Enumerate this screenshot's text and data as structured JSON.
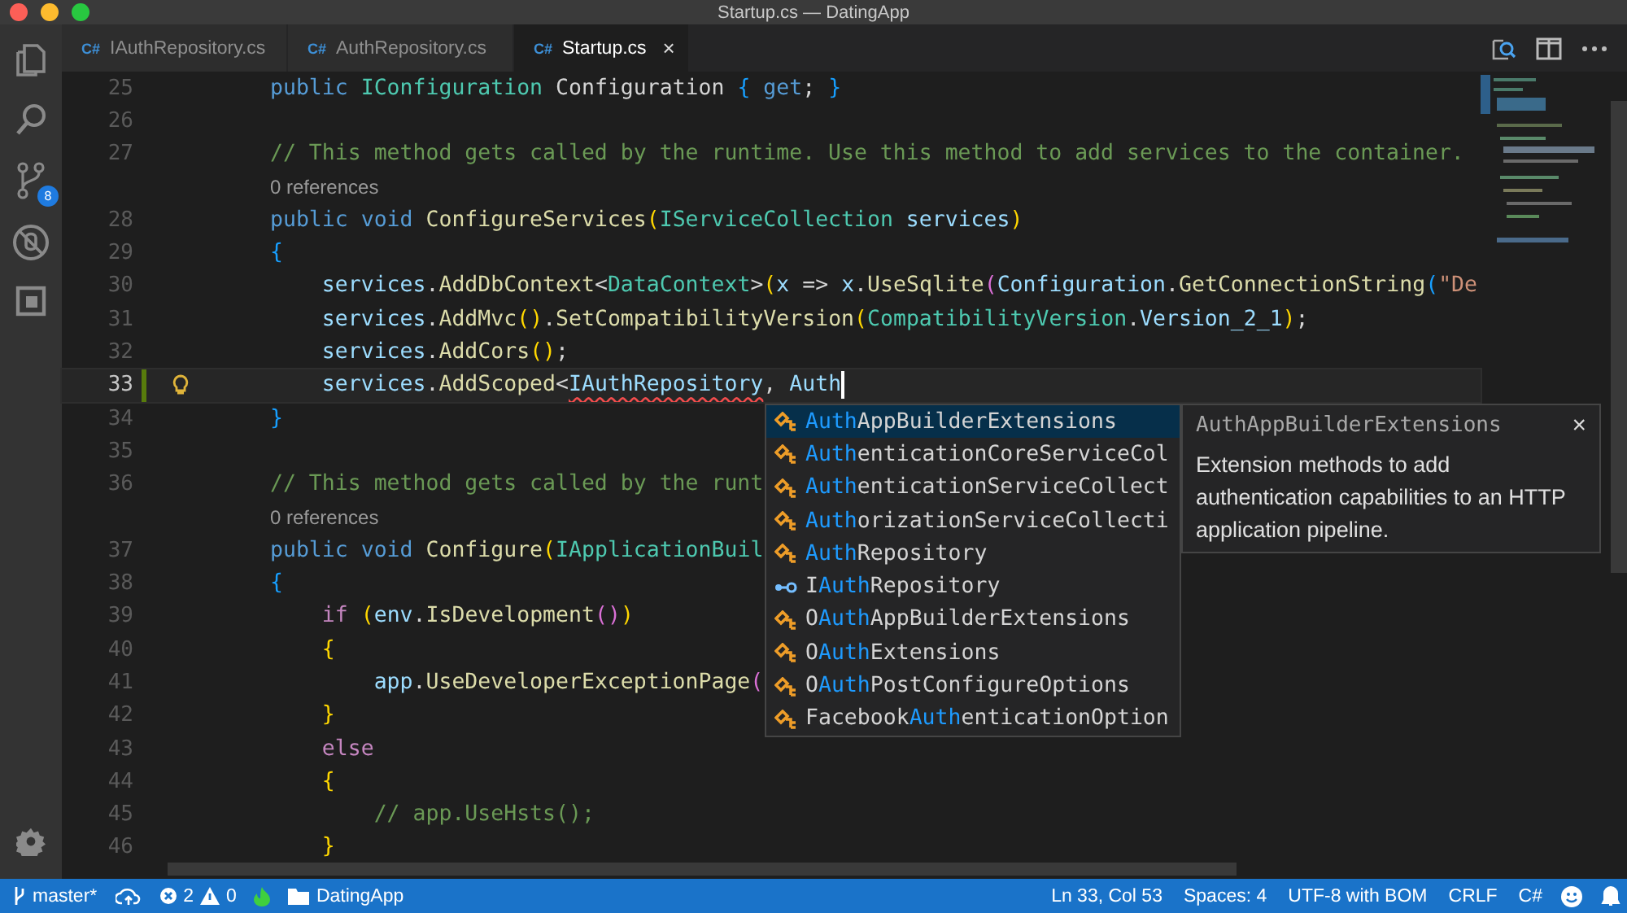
{
  "window": {
    "title": "Startup.cs — DatingApp"
  },
  "activity_bar": {
    "source_control_badge": "8"
  },
  "tabs": [
    {
      "icon_text": "C#",
      "label": "IAuthRepository.cs",
      "selected": false
    },
    {
      "icon_text": "C#",
      "label": "AuthRepository.cs",
      "selected": false
    },
    {
      "icon_text": "C#",
      "label": "Startup.cs",
      "selected": true,
      "close": "×"
    }
  ],
  "rows": [
    {
      "kind": "code",
      "number": "25",
      "tokens": [
        {
          "t": "public",
          "kind": "keyword"
        },
        {
          "t": " IConfiguration",
          "kind": "type"
        },
        {
          "t": " Configuration ",
          "kind": "plain"
        },
        {
          "t": "{",
          "kind": "bracket3"
        },
        {
          "t": " get",
          "kind": "keyword"
        },
        {
          "t": "; ",
          "kind": "plain"
        },
        {
          "t": "}",
          "kind": "bracket3"
        }
      ]
    },
    {
      "kind": "code",
      "number": "26"
    },
    {
      "kind": "code",
      "number": "27",
      "tokens": [
        {
          "t": "// This method gets called by the runtime. Use this method to add services to the container.",
          "kind": "comment"
        }
      ]
    },
    {
      "kind": "codelens",
      "text": "0 references"
    },
    {
      "kind": "code",
      "number": "28",
      "tokens": [
        {
          "t": "public",
          "kind": "keyword"
        },
        {
          "t": " void",
          "kind": "keyword"
        },
        {
          "t": " ConfigureServices",
          "kind": "function"
        },
        {
          "t": "(",
          "kind": "bracket1"
        },
        {
          "t": "IServiceCollection",
          "kind": "type"
        },
        {
          "t": " services",
          "kind": "variable"
        },
        {
          "t": ")",
          "kind": "bracket1"
        }
      ]
    },
    {
      "kind": "code",
      "number": "29",
      "tokens": [
        {
          "t": "{",
          "kind": "bracket3"
        }
      ]
    },
    {
      "kind": "code",
      "number": "30",
      "tokens": [
        {
          "t": "    services",
          "kind": "variable"
        },
        {
          "t": ".",
          "kind": "plain"
        },
        {
          "t": "AddDbContext",
          "kind": "function"
        },
        {
          "t": "<",
          "kind": "plain"
        },
        {
          "t": "DataContext",
          "kind": "type"
        },
        {
          "t": ">",
          "kind": "plain"
        },
        {
          "t": "(",
          "kind": "bracket1"
        },
        {
          "t": "x",
          "kind": "variable"
        },
        {
          "t": " => ",
          "kind": "plain"
        },
        {
          "t": "x",
          "kind": "variable"
        },
        {
          "t": ".",
          "kind": "plain"
        },
        {
          "t": "UseSqlite",
          "kind": "function"
        },
        {
          "t": "(",
          "kind": "bracket2"
        },
        {
          "t": "Configuration",
          "kind": "variable"
        },
        {
          "t": ".",
          "kind": "plain"
        },
        {
          "t": "GetConnectionString",
          "kind": "function"
        },
        {
          "t": "(",
          "kind": "bracket3"
        },
        {
          "t": "\"De",
          "kind": "string"
        }
      ]
    },
    {
      "kind": "code",
      "number": "31",
      "tokens": [
        {
          "t": "    services",
          "kind": "variable"
        },
        {
          "t": ".",
          "kind": "plain"
        },
        {
          "t": "AddMvc",
          "kind": "function"
        },
        {
          "t": "()",
          "kind": "bracket1"
        },
        {
          "t": ".",
          "kind": "plain"
        },
        {
          "t": "SetCompatibilityVersion",
          "kind": "function"
        },
        {
          "t": "(",
          "kind": "bracket1"
        },
        {
          "t": "CompatibilityVersion",
          "kind": "type"
        },
        {
          "t": ".",
          "kind": "plain"
        },
        {
          "t": "Version_2_1",
          "kind": "variable"
        },
        {
          "t": ")",
          "kind": "bracket1"
        },
        {
          "t": ";",
          "kind": "plain"
        }
      ]
    },
    {
      "kind": "code",
      "number": "32",
      "tokens": [
        {
          "t": "    services",
          "kind": "variable"
        },
        {
          "t": ".",
          "kind": "plain"
        },
        {
          "t": "AddCors",
          "kind": "function"
        },
        {
          "t": "()",
          "kind": "bracket1"
        },
        {
          "t": ";",
          "kind": "plain"
        }
      ]
    },
    {
      "kind": "code",
      "number": "33",
      "current": true,
      "modified": true,
      "lightbulb": true,
      "tokens": [
        {
          "t": "    services",
          "kind": "variable"
        },
        {
          "t": ".",
          "kind": "plain"
        },
        {
          "t": "AddScoped",
          "kind": "function"
        },
        {
          "t": "<",
          "kind": "plain"
        },
        {
          "t": "IAuthRepository",
          "kind": "variable",
          "error": true
        },
        {
          "t": ", ",
          "kind": "plain"
        },
        {
          "t": "Auth",
          "kind": "variable"
        }
      ]
    },
    {
      "kind": "code",
      "number": "34",
      "tokens": [
        {
          "t": "}",
          "kind": "bracket3"
        }
      ]
    },
    {
      "kind": "code",
      "number": "35"
    },
    {
      "kind": "code",
      "number": "36",
      "tokens": [
        {
          "t": "// This method gets called by the runt",
          "kind": "comment"
        }
      ]
    },
    {
      "kind": "codelens",
      "text": "0 references"
    },
    {
      "kind": "code",
      "number": "37",
      "tokens": [
        {
          "t": "public",
          "kind": "keyword"
        },
        {
          "t": " void",
          "kind": "keyword"
        },
        {
          "t": " Configure",
          "kind": "function"
        },
        {
          "t": "(",
          "kind": "bracket1"
        },
        {
          "t": "IApplicationBuil",
          "kind": "type"
        }
      ]
    },
    {
      "kind": "code",
      "number": "38",
      "tokens": [
        {
          "t": "{",
          "kind": "bracket3"
        }
      ]
    },
    {
      "kind": "code",
      "number": "39",
      "tokens": [
        {
          "t": "    if",
          "kind": "control"
        },
        {
          "t": " (",
          "kind": "bracket1"
        },
        {
          "t": "env",
          "kind": "variable"
        },
        {
          "t": ".",
          "kind": "plain"
        },
        {
          "t": "IsDevelopment",
          "kind": "function"
        },
        {
          "t": "()",
          "kind": "bracket2"
        },
        {
          "t": ")",
          "kind": "bracket1"
        }
      ]
    },
    {
      "kind": "code",
      "number": "40",
      "tokens": [
        {
          "t": "    {",
          "kind": "bracket1"
        }
      ]
    },
    {
      "kind": "code",
      "number": "41",
      "tokens": [
        {
          "t": "        app",
          "kind": "variable"
        },
        {
          "t": ".",
          "kind": "plain"
        },
        {
          "t": "UseDeveloperExceptionPage",
          "kind": "function"
        },
        {
          "t": "(",
          "kind": "bracket2"
        }
      ]
    },
    {
      "kind": "code",
      "number": "42",
      "tokens": [
        {
          "t": "    }",
          "kind": "bracket1"
        }
      ]
    },
    {
      "kind": "code",
      "number": "43",
      "tokens": [
        {
          "t": "    else",
          "kind": "control"
        }
      ]
    },
    {
      "kind": "code",
      "number": "44",
      "tokens": [
        {
          "t": "    {",
          "kind": "bracket1"
        }
      ]
    },
    {
      "kind": "code",
      "number": "45",
      "tokens": [
        {
          "t": "        // app.UseHsts();",
          "kind": "comment"
        }
      ]
    },
    {
      "kind": "code",
      "number": "46",
      "tokens": [
        {
          "t": "    }",
          "kind": "bracket1"
        }
      ]
    }
  ],
  "suggestions": [
    {
      "kind": "class",
      "match": "Auth",
      "after": "AppBuilderExtensions",
      "selected": true
    },
    {
      "kind": "class",
      "match": "Auth",
      "after": "enticationCoreServiceCol",
      "selected": false
    },
    {
      "kind": "class",
      "match": "Auth",
      "after": "enticationServiceCollect",
      "selected": false
    },
    {
      "kind": "class",
      "match": "Auth",
      "after": "orizationServiceCollecti",
      "selected": false
    },
    {
      "kind": "class",
      "match": "Auth",
      "after": "Repository",
      "selected": false
    },
    {
      "kind": "interface",
      "before": "I",
      "match": "Auth",
      "after": "Repository",
      "selected": false
    },
    {
      "kind": "class",
      "before": "O",
      "match": "Auth",
      "after": "AppBuilderExtensions",
      "selected": false
    },
    {
      "kind": "class",
      "before": "O",
      "match": "Auth",
      "after": "Extensions",
      "selected": false
    },
    {
      "kind": "class",
      "before": "O",
      "match": "Auth",
      "after": "PostConfigureOptions",
      "selected": false
    },
    {
      "kind": "class",
      "before": "Facebook",
      "match": "Auth",
      "after": "enticationOption",
      "selected": false
    }
  ],
  "suggestion_detail": {
    "title": "AuthAppBuilderExtensions",
    "close": "×",
    "description": "Extension methods to add authentication capabilities to an HTTP application pipeline."
  },
  "status_bar": {
    "branch": "master*",
    "errors": "2",
    "warnings": "0",
    "folder": "DatingApp",
    "right": [
      "Ln 33, Col 53",
      "Spaces: 4",
      "UTF-8 with BOM",
      "CRLF",
      "C#"
    ]
  }
}
